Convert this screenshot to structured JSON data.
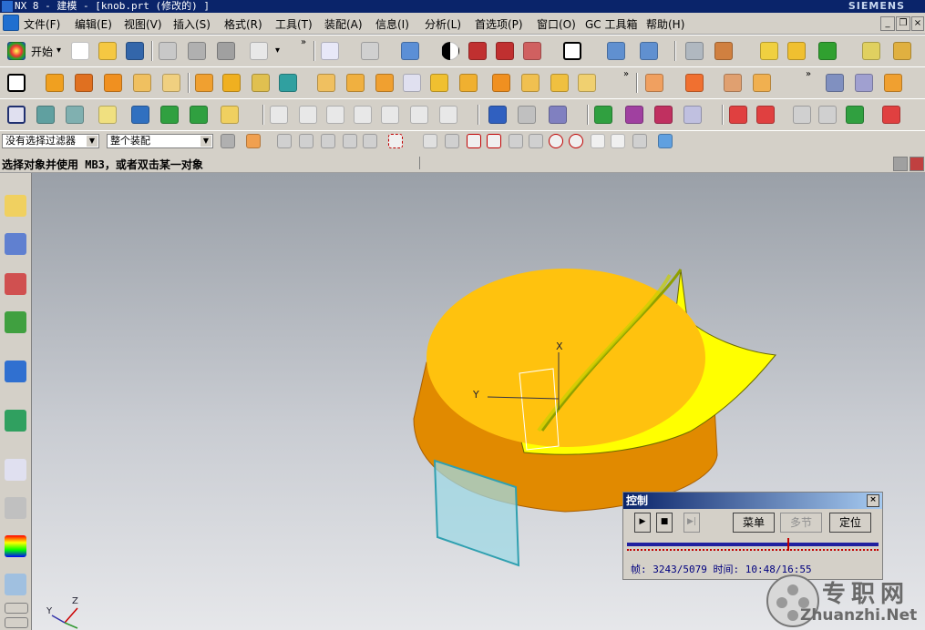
{
  "window": {
    "title": "NX 8 - 建模 - [knob.prt (修改的) ]",
    "brand": "SIEMENS"
  },
  "menu": [
    "文件(F)",
    "编辑(E)",
    "视图(V)",
    "插入(S)",
    "格式(R)",
    "工具(T)",
    "装配(A)",
    "信息(I)",
    "分析(L)",
    "首选项(P)",
    "窗口(O)",
    "GC 工具箱",
    "帮助(H)"
  ],
  "toolbar": {
    "start_label": "开始",
    "filter_dropdown": "没有选择过滤器",
    "scope_dropdown": "整个装配"
  },
  "cue_line": "选择对象并使用 MB3，或者双击某一对象",
  "colors": {
    "accent_title": "#0a246a",
    "part_top": "#ffc20e",
    "part_side": "#e18a00",
    "sheet_yellow": "#ffff00",
    "plane_cyan": "#9fd8e4"
  },
  "axis_labels": [
    "X",
    "Y",
    "Z"
  ],
  "motion_panel": {
    "title": "控制",
    "close_label": "×",
    "buttons": {
      "play_label": "▶",
      "stop_label": "■",
      "step_label": "▶|",
      "menu_label": "菜单",
      "multi_label": "多节",
      "position_label": "定位"
    },
    "progress": 0.638,
    "status": "帧: 3243/5079 时间: 10:48/16:55"
  },
  "watermark": {
    "cn": "专职网",
    "en": "Zhuanzhi.Net"
  },
  "icons": [
    "nx-logo-icon",
    "new-file-icon",
    "open-folder-icon",
    "save-icon",
    "cut-icon",
    "copy-icon",
    "paste-icon",
    "undo-icon",
    "sketch-icon",
    "block-icon",
    "cylinder-icon",
    "sphere-icon",
    "extrude-icon",
    "chamfer-icon",
    "assembly-icon",
    "measure-icon",
    "clock-icon",
    "palette-icon",
    "play-icon",
    "stop-icon"
  ]
}
